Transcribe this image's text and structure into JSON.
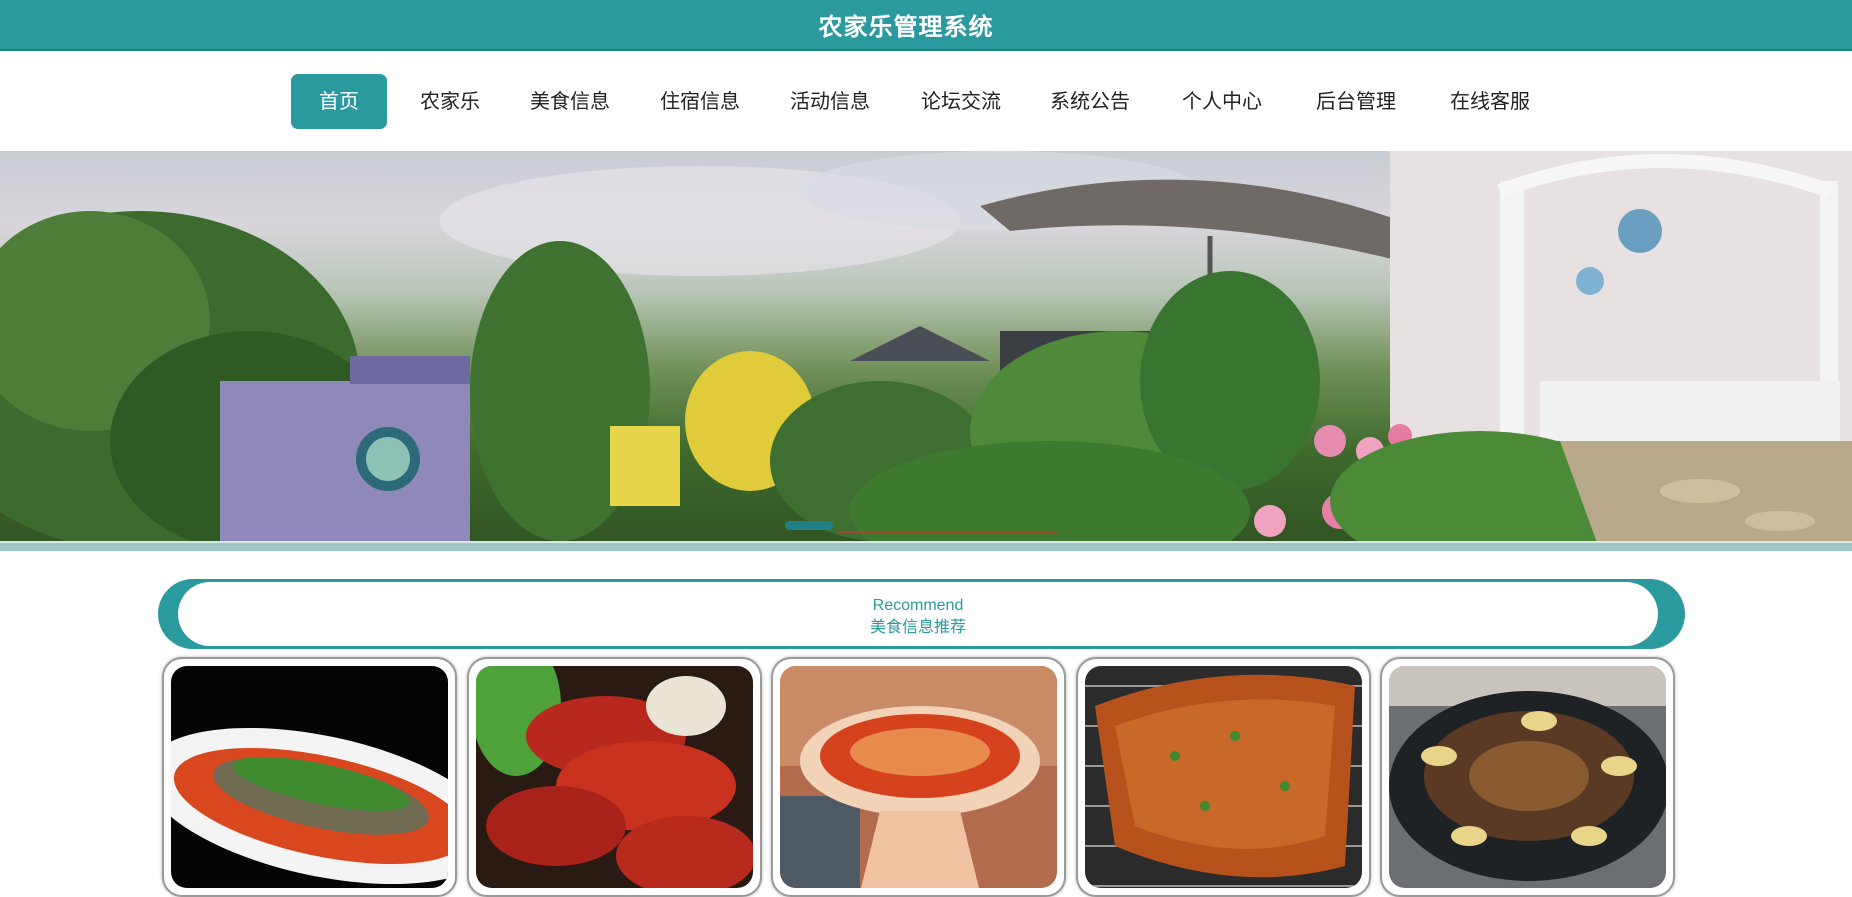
{
  "header": {
    "title": "农家乐管理系统"
  },
  "nav": {
    "items": [
      {
        "label": "首页"
      },
      {
        "label": "农家乐"
      },
      {
        "label": "美食信息"
      },
      {
        "label": "住宿信息"
      },
      {
        "label": "活动信息"
      },
      {
        "label": "论坛交流"
      },
      {
        "label": "系统公告"
      },
      {
        "label": "个人中心"
      },
      {
        "label": "后台管理"
      },
      {
        "label": "在线客服"
      }
    ],
    "active_index": 0
  },
  "banner": {
    "image": "farmhouse-garden-photo",
    "carousel": {
      "active_slide": 1
    }
  },
  "recommend": {
    "title_en": "Recommend",
    "title_cn": "美食信息推荐"
  },
  "foods": [
    {
      "image": "braised-fish-dish-photo"
    },
    {
      "image": "crayfish-dish-photo"
    },
    {
      "image": "mapo-tofu-dish-photo"
    },
    {
      "image": "grilled-fish-dish-photo"
    },
    {
      "image": "hotpot-dish-photo"
    }
  ],
  "colors": {
    "accent": "#2a9a9e",
    "accent_dark": "#1f8186"
  }
}
